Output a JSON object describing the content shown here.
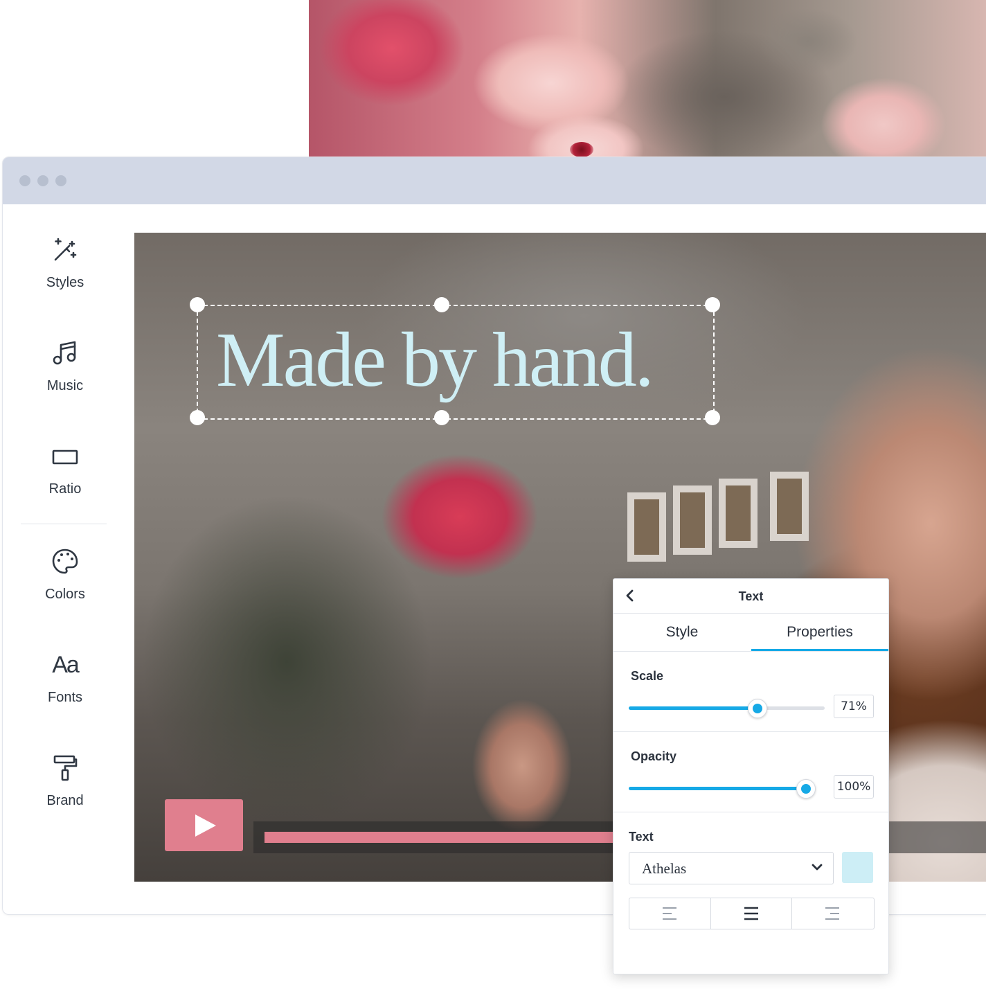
{
  "sidebar": {
    "items": [
      {
        "label": "Styles",
        "icon": "magic-wand-icon"
      },
      {
        "label": "Music",
        "icon": "music-note-icon"
      },
      {
        "label": "Ratio",
        "icon": "rectangle-icon"
      },
      {
        "label": "Colors",
        "icon": "palette-icon"
      },
      {
        "label": "Fonts",
        "icon": "font-icon",
        "glyph": "Aa"
      },
      {
        "label": "Brand",
        "icon": "paint-roller-icon"
      }
    ]
  },
  "canvas": {
    "headline": "Made by hand.",
    "headline_color": "#cfeff5",
    "playback_progress": 0.51
  },
  "panel": {
    "title": "Text",
    "tabs": [
      {
        "label": "Style",
        "active": false
      },
      {
        "label": "Properties",
        "active": true
      }
    ],
    "scale": {
      "label": "Scale",
      "value_text": "71%",
      "value": 71
    },
    "opacity": {
      "label": "Opacity",
      "value_text": "100%",
      "value": 100
    },
    "text": {
      "label": "Text",
      "font": "Athelas",
      "color": "#cdeef6",
      "alignment": [
        "align-left",
        "align-center",
        "align-right"
      ],
      "selected_alignment": "align-center"
    }
  },
  "colors": {
    "accent": "#16a9e6",
    "play_button": "#e07f8e",
    "window_bar": "#d2d8e6"
  }
}
